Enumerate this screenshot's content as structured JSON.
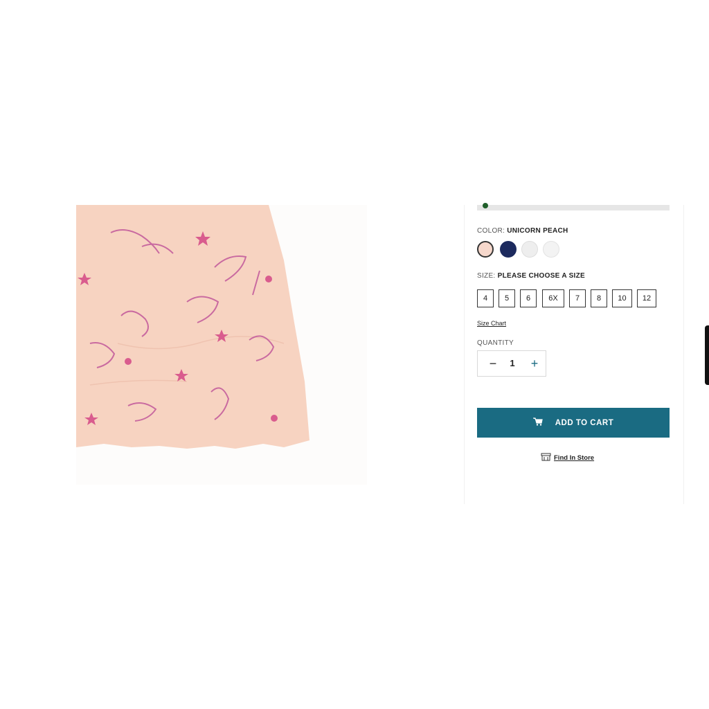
{
  "product": {
    "image_alt": "",
    "color": {
      "label": "COLOR:",
      "value": "UNICORN PEACH",
      "swatches": [
        {
          "name": "unicorn-peach",
          "color": "#f6d8cc",
          "selected": true
        },
        {
          "name": "navy",
          "color": "#1c2a5e",
          "selected": false
        },
        {
          "name": "white-print",
          "color": "#eeeeee",
          "selected": false
        },
        {
          "name": "light-grey",
          "color": "#f3f3f3",
          "selected": false
        }
      ]
    },
    "size": {
      "label": "SIZE:",
      "value": "PLEASE CHOOSE A SIZE",
      "options": [
        "4",
        "5",
        "6",
        "6X",
        "7",
        "8",
        "10",
        "12"
      ]
    },
    "size_chart_label": "Size Chart",
    "quantity": {
      "label": "QUANTITY",
      "value": "1",
      "minus": "−",
      "plus": "+"
    },
    "add_to_cart_label": "ADD TO CART",
    "find_in_store_label": "Find In Store",
    "colors": {
      "accent": "#1a6b82",
      "dress": "#f7d3c1"
    }
  }
}
